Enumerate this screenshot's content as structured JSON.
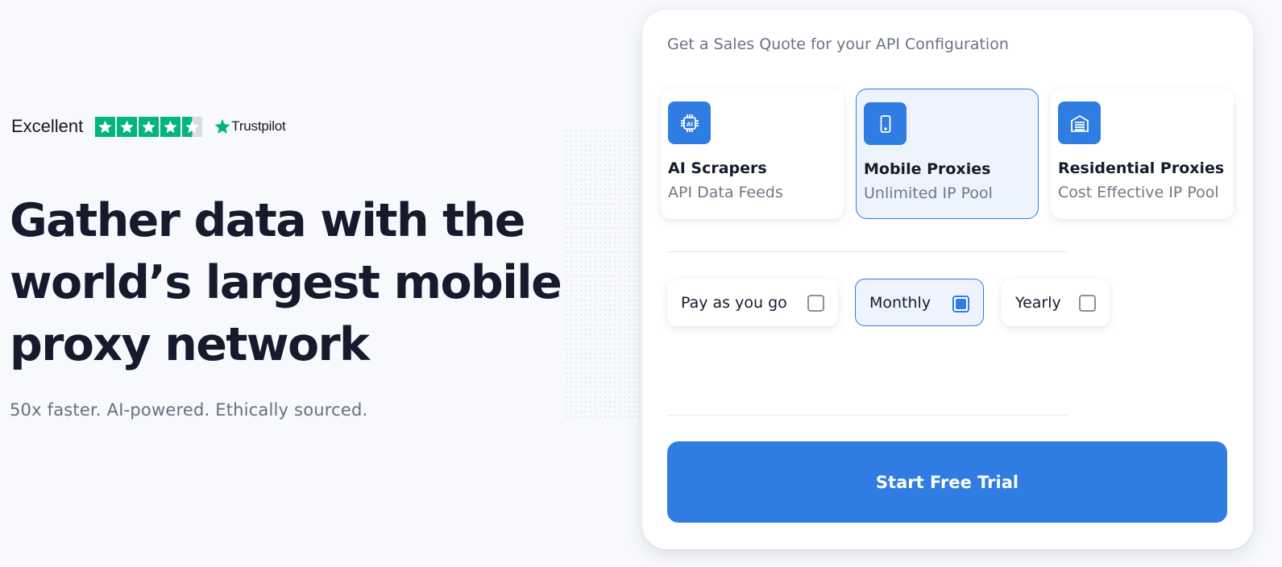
{
  "trustpilot": {
    "rating_word": "Excellent",
    "brand": "Trustpilot",
    "stars": 4.5,
    "star_color": "#00b67a"
  },
  "hero": {
    "headline_lines": [
      "Gather data with the",
      "world’s largest mobile",
      "proxy network"
    ],
    "subline": "50x faster. AI-powered. Ethically sourced."
  },
  "quote_card": {
    "title": "Get a Sales Quote for your API Configuration",
    "products": [
      {
        "name": "AI Scrapers",
        "sub": "API Data Feeds",
        "icon": "ai-chip-icon",
        "selected": false
      },
      {
        "name": "Mobile Proxies",
        "sub": "Unlimited IP Pool",
        "icon": "mobile-phone-icon",
        "selected": true
      },
      {
        "name": "Residential Proxies",
        "sub": "Cost Effective IP Pool",
        "icon": "warehouse-icon",
        "selected": false
      }
    ],
    "billing": [
      {
        "label": "Pay as you go",
        "checked": false
      },
      {
        "label": "Monthly",
        "checked": true
      },
      {
        "label": "Yearly",
        "checked": false
      }
    ],
    "cta_label": "Start Free Trial"
  },
  "colors": {
    "accent": "#2f7ce2",
    "selected_bg": "#eef4fe",
    "text_dark": "#151b2c",
    "text_muted": "#6a7282"
  }
}
